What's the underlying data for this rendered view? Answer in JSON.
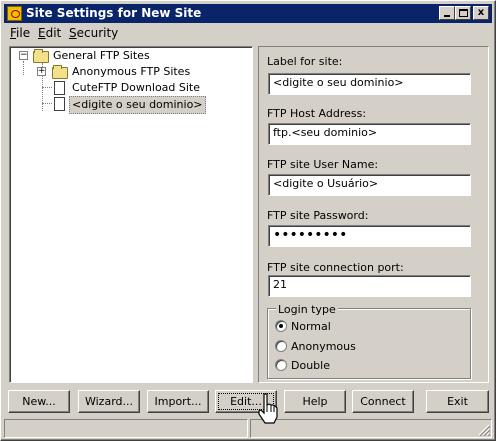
{
  "window": {
    "title": "Site Settings for New Site"
  },
  "titlebar_buttons": {
    "minimize": "minimize",
    "maximize": "maximize",
    "close": "x"
  },
  "menu": [
    "File",
    "Edit",
    "Security"
  ],
  "tree": {
    "root": "General FTP Sites",
    "children": [
      "Anonymous FTP Sites",
      "CuteFTP Download Site",
      "<digite o seu dominio>"
    ]
  },
  "form": {
    "label_for_site": {
      "label": "Label for site:",
      "value": "<digite o seu dominio>"
    },
    "host_address": {
      "label": "FTP Host Address:",
      "value": "ftp.<seu dominio>"
    },
    "user_name": {
      "label": "FTP site User Name:",
      "value": "<digite o Usuário>"
    },
    "password": {
      "label": "FTP site Password:",
      "value": "•••••••••"
    },
    "port": {
      "label": "FTP site connection port:",
      "value": "21"
    },
    "login_type": {
      "title": "Login type",
      "options": [
        "Normal",
        "Anonymous",
        "Double"
      ],
      "selected": "Normal"
    }
  },
  "buttons": [
    "New...",
    "Wizard...",
    "Import...",
    "Edit...",
    "Help",
    "Connect",
    "Exit"
  ],
  "colors": {
    "titlebar": "#0a246a",
    "face": "#d4d0c8"
  }
}
